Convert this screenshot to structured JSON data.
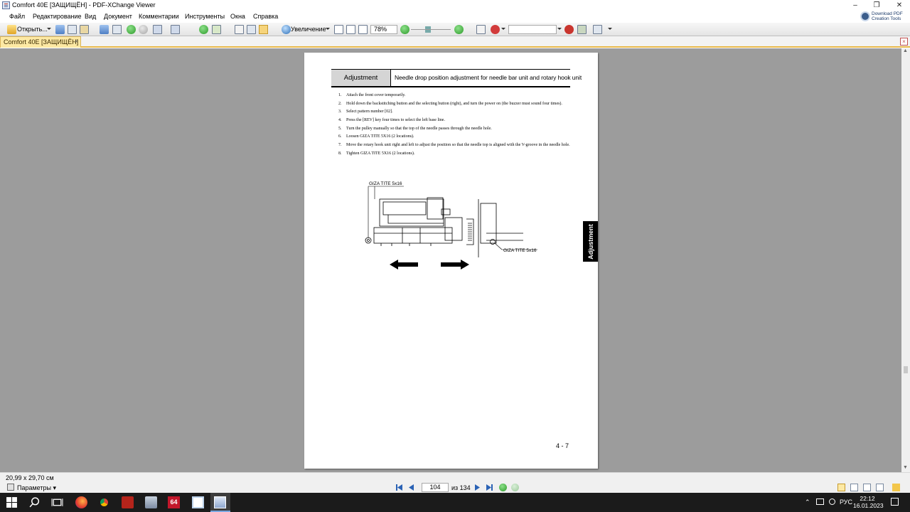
{
  "window": {
    "title": "Comfort 40E [ЗАЩИЩЁН] - PDF-XChange Viewer",
    "minimize": "–",
    "maximize": "❐",
    "close": "✕"
  },
  "menu": [
    "Файл",
    "Редактирование",
    "Вид",
    "Документ",
    "Комментарии",
    "Инструменты",
    "Окна",
    "Справка"
  ],
  "promo": {
    "line1": "Download PDF",
    "line2": "Creation Tools"
  },
  "toolbar": {
    "open_label": "Открыть...",
    "zoom_label": "Увеличение",
    "zoom_value": "78%",
    "search_value": ""
  },
  "tab": {
    "label": "Comfort 40E [ЗАЩИЩЁН]",
    "close": "×"
  },
  "document": {
    "header_left": "Adjustment",
    "header_right": "Needle drop position adjustment for needle bar unit and rotary hook unit",
    "steps": [
      {
        "n": "1.",
        "text": "Attach the front cover temporarily."
      },
      {
        "n": "2.",
        "text": "Hold down the backstitching button and the selecting button (right), and turn the power on (the buzzer must sound four times)."
      },
      {
        "n": "3.",
        "text": "Select pattern number [02]."
      },
      {
        "n": "4.",
        "text": "Press the [REV] key four times to select the left base line."
      },
      {
        "n": "5.",
        "text": "Turn the pulley manually so that the top of the needle passes through the needle hole."
      },
      {
        "n": "6.",
        "text": "Loosen GIZA TITE 5X16 (2 locations)."
      },
      {
        "n": "7.",
        "text": "Move the rotary hook unit right and left to adjust the position so that the needle top is aligned with the V-groove in the needle hole."
      },
      {
        "n": "8.",
        "text": "Tighten GIZA TITE 5X16 (2 locations)."
      }
    ],
    "diagram_label_top": "GIZA TITE 5x16",
    "diagram_label_right": "GIZA TITE 5x16",
    "side_tab": "Adjustment",
    "page_number": "4 - 7"
  },
  "status": {
    "page_size": "20,99 x 29,70 см",
    "params_label": "Параметры",
    "current_page": "104",
    "of_pages": "из 134"
  },
  "taskbar": {
    "tray_lang": "РУС",
    "time": "22:12",
    "date": "16.01.2023"
  }
}
